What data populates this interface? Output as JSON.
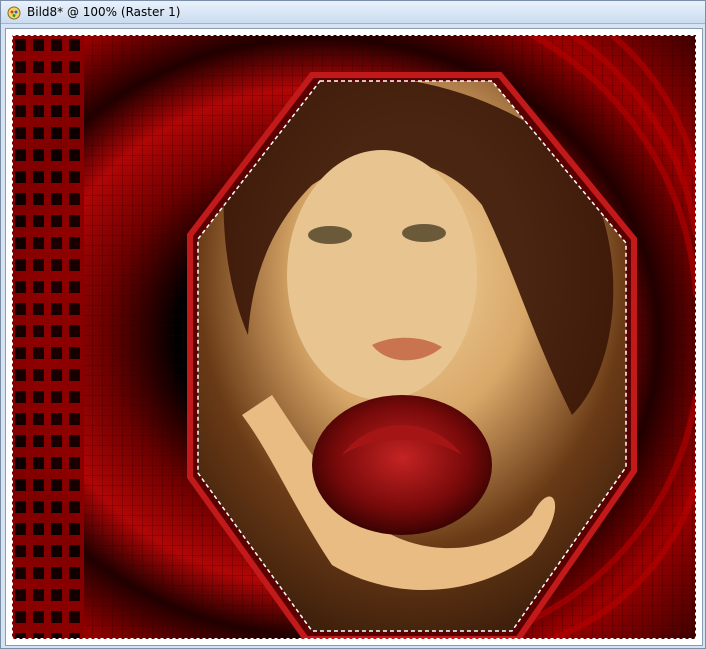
{
  "window": {
    "title": "Bild8* @ 100% (Raster 1)",
    "icon": "psp-document-icon"
  },
  "canvas": {
    "selection": "octagon-marching-ants",
    "colors": {
      "red": "#b00000",
      "dark": "#1a0000",
      "skin": "#e7c08a",
      "rose": "#7a0a0a"
    }
  }
}
